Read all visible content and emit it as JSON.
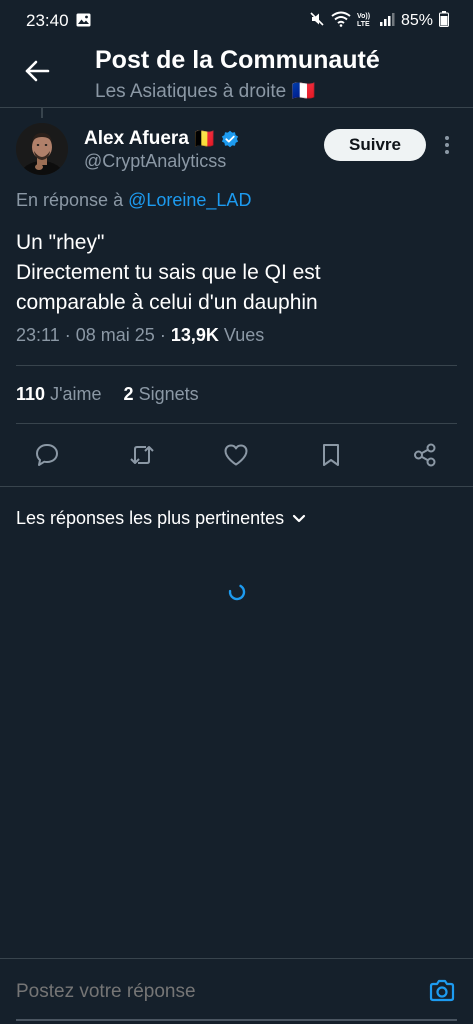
{
  "status_bar": {
    "time": "23:40",
    "battery": "85%",
    "icons": [
      "gallery-icon",
      "mute-icon",
      "wifi-icon",
      "volte-icon",
      "signal-icon",
      "battery-icon"
    ]
  },
  "header": {
    "title": "Post de la Communauté",
    "subtitle": "Les Asiatiques à droite",
    "subtitle_flag": "🇫🇷"
  },
  "post": {
    "author": {
      "name": "Alex Afuera",
      "name_flag": "🇧🇪",
      "verified": true,
      "handle": "@CryptAnalyticss"
    },
    "follow_label": "Suivre",
    "reply_prefix": "En réponse à",
    "reply_mention": "@Loreine_LAD",
    "text_lines": [
      "Un \"rhey\"",
      "Directement tu sais que le QI est",
      "comparable à celui d'un dauphin"
    ],
    "time": "23:11",
    "date": "08 mai 25",
    "views_count": "13,9K",
    "views_label": "Vues",
    "likes_count": "110",
    "likes_label": "J'aime",
    "bookmarks_count": "2",
    "bookmarks_label": "Signets"
  },
  "sort": {
    "label": "Les réponses les plus pertinentes"
  },
  "composer": {
    "placeholder": "Postez votre réponse"
  },
  "colors": {
    "background": "#15202b",
    "accent": "#1d9bf0",
    "muted": "#8b98a5",
    "border": "#38444d"
  }
}
